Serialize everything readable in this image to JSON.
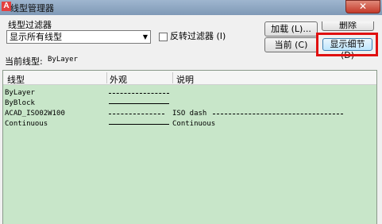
{
  "window": {
    "title": "线型管理器",
    "app_icon": "A",
    "close_glyph": "✕"
  },
  "filter": {
    "group_label": "线型过滤器",
    "selected": "显示所有线型",
    "invert_label": "反转过滤器 (I)",
    "invert_checked": false
  },
  "buttons": {
    "load": "加载 (L)...",
    "delete": "删除",
    "current": "当前 (C)",
    "show_details": "显示细节 (D)"
  },
  "current": {
    "label": "当前线型:",
    "value": "ByLayer"
  },
  "table": {
    "columns": [
      "线型",
      "外观",
      "说明"
    ],
    "rows": [
      {
        "name": "ByLayer",
        "appearance": "dashed",
        "description": ""
      },
      {
        "name": "ByBlock",
        "appearance": "solid",
        "description": ""
      },
      {
        "name": "ACAD_ISO02W100",
        "appearance": "iso-dash",
        "description": "ISO dash"
      },
      {
        "name": "Continuous",
        "appearance": "solid",
        "description": "Continuous"
      }
    ]
  },
  "colors": {
    "list_background": "#c8e6c9",
    "highlight": "#e01010"
  }
}
